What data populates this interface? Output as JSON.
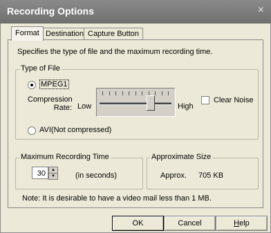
{
  "window": {
    "title": "Recording Options",
    "close_glyph": "×"
  },
  "tabs": [
    {
      "label": "Format"
    },
    {
      "label": "Destination"
    },
    {
      "label": "Capture Button"
    }
  ],
  "format": {
    "description": "Specifies the type of file and the maximum recording time.",
    "type_of_file": {
      "group_label": "Type of File",
      "mpeg1_label": "MPEG1",
      "mpeg1_selected": true,
      "compression_label_line1": "Compression",
      "compression_label_line2": "Rate:",
      "low_label": "Low",
      "high_label": "High",
      "slider_level": 0.72,
      "clear_noise_label": "Clear Noise",
      "clear_noise_checked": false,
      "avi_label": "AVI(Not compressed)"
    },
    "max_time": {
      "group_label": "Maximum Recording Time",
      "value": "30",
      "unit_label": "(in seconds)"
    },
    "approx_size": {
      "group_label": "Approximate Size",
      "prefix": "Approx.",
      "value": "705 KB"
    },
    "note": "Note: It is desirable to have a video mail less than 1 MB."
  },
  "buttons": {
    "ok": "OK",
    "cancel": "Cancel",
    "help": "Help"
  }
}
